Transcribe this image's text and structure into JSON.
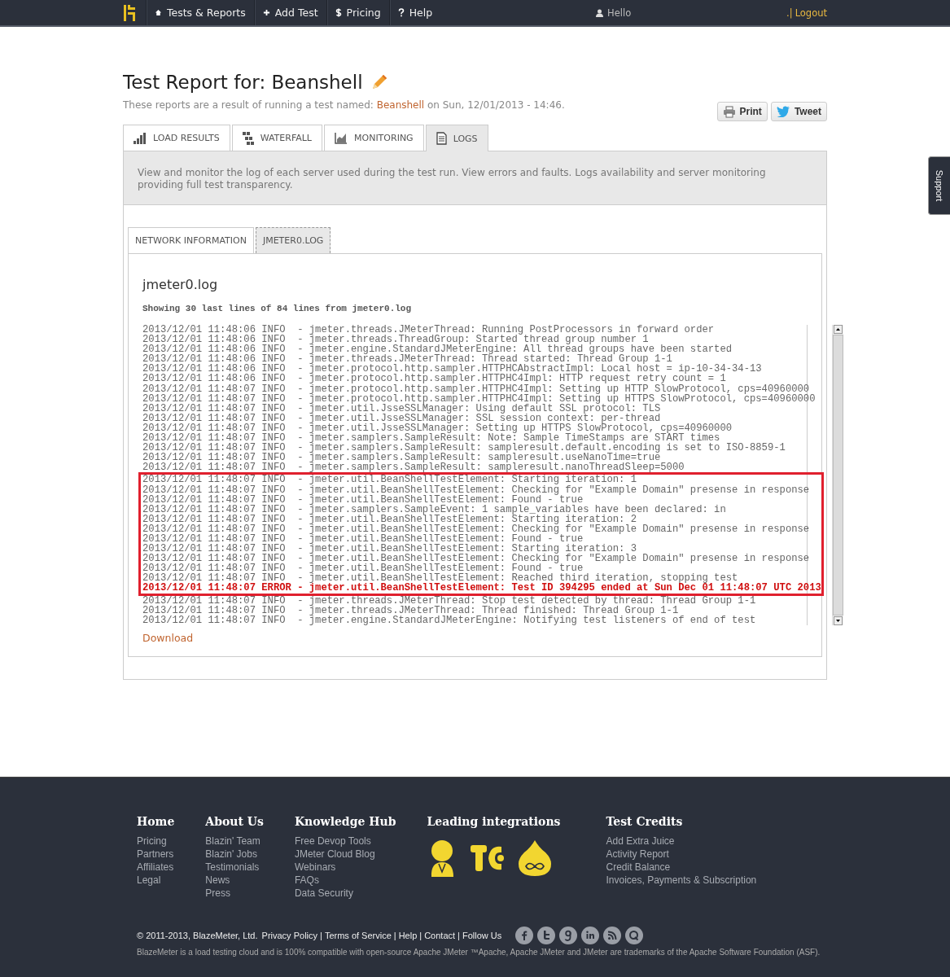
{
  "nav": {
    "items": [
      {
        "label": "Tests & Reports"
      },
      {
        "label": "Add Test"
      },
      {
        "label": "Pricing"
      },
      {
        "label": "Help"
      }
    ],
    "user": "Hello",
    "logout_prefix": ".|",
    "logout": "Logout"
  },
  "title": "Test Report for: Beanshell",
  "subtitle": {
    "before": "These reports are a result of running a test named:",
    "link": "Beanshell",
    "after": "on Sun, 12/01/2013 - 14:46."
  },
  "share_buttons": [
    {
      "label": "Print"
    },
    {
      "label": "Tweet"
    }
  ],
  "tabs": [
    {
      "label": "LOAD RESULTS",
      "selected": false
    },
    {
      "label": "WATERFALL",
      "selected": false
    },
    {
      "label": "MONITORING",
      "selected": false
    },
    {
      "label": "LOGS",
      "selected": true
    }
  ],
  "description": "View and monitor the log of each server used during the test run. View errors and faults. Logs availability and server monitoring providing full test transparency.",
  "subtabs": [
    {
      "label": "NETWORK INFORMATION",
      "selected": false
    },
    {
      "label": "JMETER0.LOG",
      "selected": true
    }
  ],
  "log": {
    "heading": "jmeter0.log",
    "summary": "Showing 30 last lines of 84 lines from jmeter0.log",
    "lines_before": [
      {
        "text": "2013/12/01 11:48:06 INFO  - jmeter.threads.JMeterThread: Running PostProcessors in forward order",
        "kind": "info"
      },
      {
        "text": "2013/12/01 11:48:06 INFO  - jmeter.threads.ThreadGroup: Started thread group number 1",
        "kind": "info"
      },
      {
        "text": "2013/12/01 11:48:06 INFO  - jmeter.engine.StandardJMeterEngine: All thread groups have been started",
        "kind": "info"
      },
      {
        "text": "2013/12/01 11:48:06 INFO  - jmeter.threads.JMeterThread: Thread started: Thread Group 1-1",
        "kind": "info"
      },
      {
        "text": "2013/12/01 11:48:06 INFO  - jmeter.protocol.http.sampler.HTTPHCAbstractImpl: Local host = ip-10-34-34-13",
        "kind": "info"
      },
      {
        "text": "2013/12/01 11:48:06 INFO  - jmeter.protocol.http.sampler.HTTPHC4Impl: HTTP request retry count = 1",
        "kind": "info"
      },
      {
        "text": "2013/12/01 11:48:07 INFO  - jmeter.protocol.http.sampler.HTTPHC4Impl: Setting up HTTP SlowProtocol, cps=40960000",
        "kind": "info"
      },
      {
        "text": "2013/12/01 11:48:07 INFO  - jmeter.protocol.http.sampler.HTTPHC4Impl: Setting up HTTPS SlowProtocol, cps=40960000",
        "kind": "info"
      },
      {
        "text": "2013/12/01 11:48:07 INFO  - jmeter.util.JsseSSLManager: Using default SSL protocol: TLS",
        "kind": "info"
      },
      {
        "text": "2013/12/01 11:48:07 INFO  - jmeter.util.JsseSSLManager: SSL session context: per-thread",
        "kind": "info"
      },
      {
        "text": "2013/12/01 11:48:07 INFO  - jmeter.util.JsseSSLManager: Setting up HTTPS SlowProtocol, cps=40960000",
        "kind": "info"
      },
      {
        "text": "2013/12/01 11:48:07 INFO  - jmeter.samplers.SampleResult: Note: Sample TimeStamps are START times",
        "kind": "info"
      },
      {
        "text": "2013/12/01 11:48:07 INFO  - jmeter.samplers.SampleResult: sampleresult.default.encoding is set to ISO-8859-1",
        "kind": "info"
      },
      {
        "text": "2013/12/01 11:48:07 INFO  - jmeter.samplers.SampleResult: sampleresult.useNanoTime=true",
        "kind": "info"
      },
      {
        "text": "2013/12/01 11:48:07 INFO  - jmeter.samplers.SampleResult: sampleresult.nanoThreadSleep=5000",
        "kind": "info"
      }
    ],
    "highlighted_lines": [
      {
        "text": "2013/12/01 11:48:07 INFO  - jmeter.util.BeanShellTestElement: Starting iteration: 1",
        "kind": "info"
      },
      {
        "text": "2013/12/01 11:48:07 INFO  - jmeter.util.BeanShellTestElement: Checking for \"Example Domain\" presense in response",
        "kind": "info"
      },
      {
        "text": "2013/12/01 11:48:07 INFO  - jmeter.util.BeanShellTestElement: Found - true",
        "kind": "info"
      },
      {
        "text": "2013/12/01 11:48:07 INFO  - jmeter.samplers.SampleEvent: 1 sample_variables have been declared: in",
        "kind": "info"
      },
      {
        "text": "2013/12/01 11:48:07 INFO  - jmeter.util.BeanShellTestElement: Starting iteration: 2",
        "kind": "info"
      },
      {
        "text": "2013/12/01 11:48:07 INFO  - jmeter.util.BeanShellTestElement: Checking for \"Example Domain\" presense in response",
        "kind": "info"
      },
      {
        "text": "2013/12/01 11:48:07 INFO  - jmeter.util.BeanShellTestElement: Found - true",
        "kind": "info"
      },
      {
        "text": "2013/12/01 11:48:07 INFO  - jmeter.util.BeanShellTestElement: Starting iteration: 3",
        "kind": "info"
      },
      {
        "text": "2013/12/01 11:48:07 INFO  - jmeter.util.BeanShellTestElement: Checking for \"Example Domain\" presense in response",
        "kind": "info"
      },
      {
        "text": "2013/12/01 11:48:07 INFO  - jmeter.util.BeanShellTestElement: Found - true",
        "kind": "info"
      },
      {
        "text": "2013/12/01 11:48:07 INFO  - jmeter.util.BeanShellTestElement: Reached third iteration, stopping test",
        "kind": "info"
      },
      {
        "text": "2013/12/01 11:48:07 ERROR - jmeter.util.BeanShellTestElement: Test ID 394295 ended at Sun Dec 01 11:48:07 UTC 2013",
        "kind": "error"
      }
    ],
    "lines_after": [
      {
        "text": "2013/12/01 11:48:07 INFO  - jmeter.threads.JMeterThread: Stop test detected by thread: Thread Group 1-1",
        "kind": "info"
      },
      {
        "text": "2013/12/01 11:48:07 INFO  - jmeter.threads.JMeterThread: Thread finished: Thread Group 1-1",
        "kind": "info"
      },
      {
        "text": "2013/12/01 11:48:07 INFO  - jmeter.engine.StandardJMeterEngine: Notifying test listeners of end of test",
        "kind": "info"
      }
    ],
    "download": "Download"
  },
  "support_tab": "Support",
  "footer": {
    "columns": [
      {
        "heading": "Home",
        "kind": "links",
        "links": [
          "Pricing",
          "Partners",
          "Affiliates",
          "Legal"
        ]
      },
      {
        "heading": "About Us",
        "kind": "links",
        "links": [
          "Blazin' Team",
          "Blazin' Jobs",
          "Testimonials",
          "News",
          "Press"
        ]
      },
      {
        "heading": "Knowledge Hub",
        "kind": "links",
        "links": [
          "Free Devop Tools",
          "JMeter Cloud Blog",
          "Webinars",
          "FAQs",
          "Data Security"
        ]
      },
      {
        "heading": "Leading integrations",
        "kind": "logos"
      },
      {
        "heading": "Test Credits",
        "kind": "links",
        "links": [
          "Add Extra Juice",
          "Activity Report",
          "Credit Balance",
          "Invoices, Payments & Subscription"
        ]
      }
    ],
    "copyright": "© 2011-2013, BlazeMeter, Ltd.",
    "legal_links": [
      "Privacy Policy",
      "Terms of Service",
      "Help",
      "Contact"
    ],
    "separator": "|",
    "follow": "Follow Us",
    "disclaimer": "BlazeMeter is a load testing cloud and is 100% compatible with open-source Apache JMeter ™Apache, Apache JMeter and JMeter are trademarks of the Apache Software Foundation (ASF)."
  }
}
